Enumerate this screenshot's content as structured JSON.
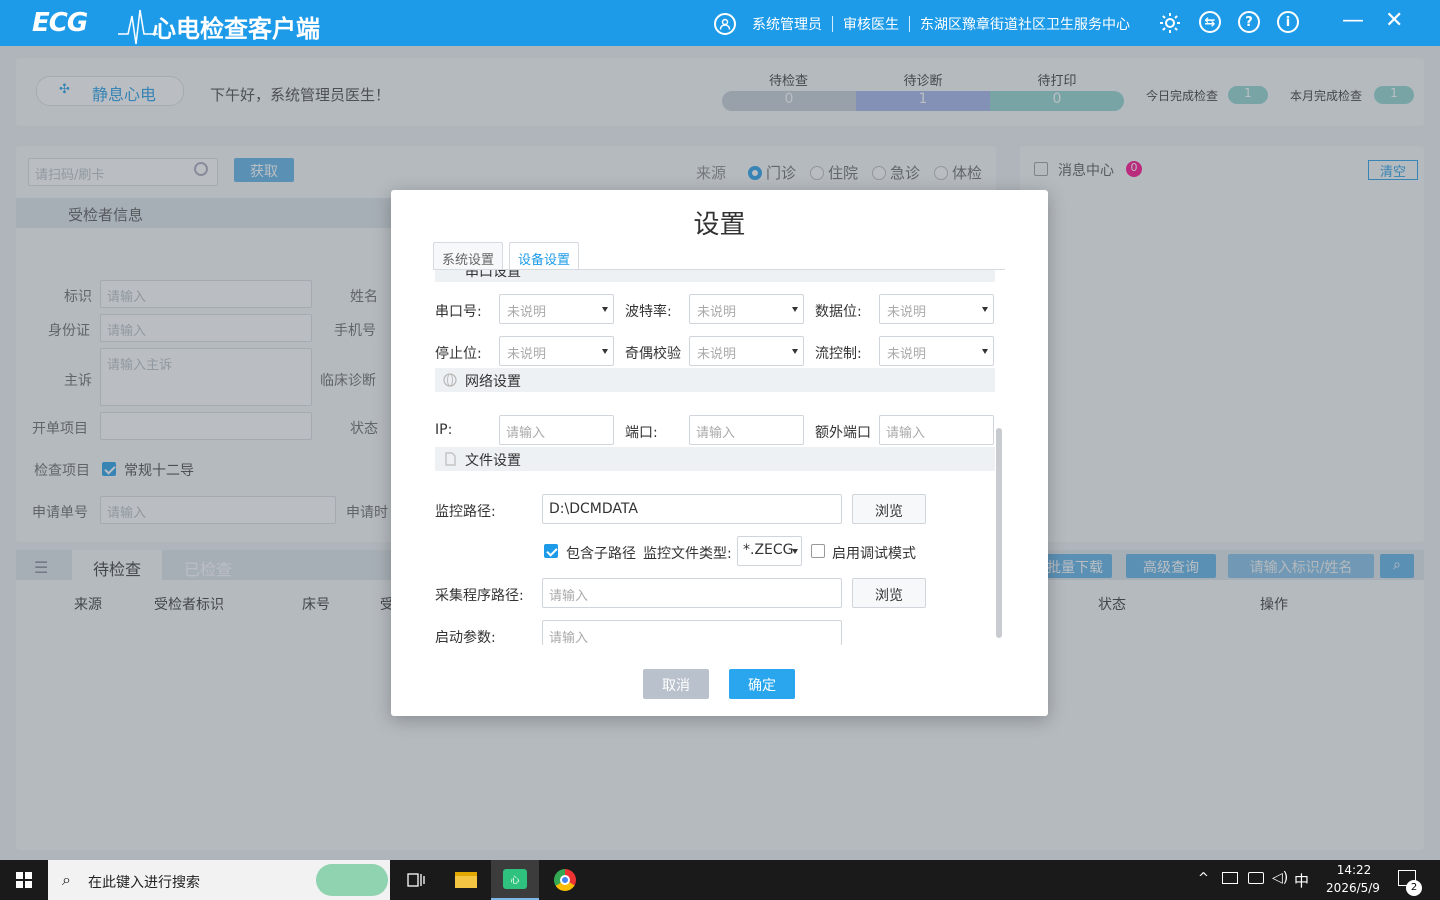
{
  "titlebar": {
    "logo": "ECG",
    "app_title": "心电检查客户端",
    "user": "系统管理员",
    "role": "审核医生",
    "org": "东湖区豫章街道社区卫生服务中心",
    "icons": [
      "gear-icon",
      "swap-icon",
      "help-icon",
      "info-icon"
    ],
    "minimize": "—",
    "close": "✕"
  },
  "header": {
    "mode_label": "静息心电",
    "greeting": "下午好，系统管理员医生！",
    "stats": [
      {
        "label": "待检查",
        "value": "0",
        "color": "#c5cdd5"
      },
      {
        "label": "待诊断",
        "value": "1",
        "color": "#9fb2e8"
      },
      {
        "label": "待打印",
        "value": "0",
        "color": "#8fd3cf"
      }
    ],
    "today_done_label": "今日完成检查",
    "today_done_value": "1",
    "month_done_label": "本月完成检查",
    "month_done_value": "1"
  },
  "scan": {
    "placeholder": "请扫码/刷卡",
    "fetch_button": "获取",
    "source_label": "来源",
    "sources": [
      "门诊",
      "住院",
      "急诊",
      "体检"
    ]
  },
  "patient": {
    "section_title": "受检者信息",
    "fields": {
      "id_label": "标识",
      "name_label": "姓名",
      "idcard_label": "身份证",
      "phone_label": "手机号",
      "complaint_label": "主诉",
      "diagnosis_label": "临床诊断",
      "order_label": "开单项目",
      "status_label": "状态",
      "exam_label": "检查项目",
      "exam_value": "常规十二导",
      "request_no_label": "申请单号",
      "request_time_label": "申请时"
    },
    "placeholder": "请输入",
    "complaint_placeholder": "请输入主诉"
  },
  "messages": {
    "title": "消息中心",
    "count": "0",
    "clear": "清空"
  },
  "list": {
    "tabs": [
      "待检查",
      "已检查"
    ],
    "columns": [
      "来源",
      "受检者标识",
      "床号",
      "受",
      "状态",
      "操作"
    ],
    "batch_download": "批量下载",
    "advanced_search": "高级查询",
    "search_placeholder": "请输入标识/姓名"
  },
  "modal": {
    "title": "设置",
    "tabs": [
      "系统设置",
      "设备设置"
    ],
    "serial_section": "串口设置",
    "serial": {
      "port_label": "串口号:",
      "baud_label": "波特率:",
      "databits_label": "数据位:",
      "stopbits_label": "停止位:",
      "parity_label": "奇偶校验",
      "flow_label": "流控制:",
      "unspecified": "未说明"
    },
    "network_section": "网络设置",
    "network": {
      "ip_label": "IP:",
      "port_label": "端口:",
      "extra_port_label": "额外端口",
      "placeholder": "请输入"
    },
    "file_section": "文件设置",
    "file": {
      "monitor_path_label": "监控路径:",
      "monitor_path_value": "D:\\DCMDATA",
      "browse": "浏览",
      "include_sub_label": "包含子路径",
      "file_type_label": "监控文件类型:",
      "file_type_value": "*.ZECG",
      "debug_label": "启用调试模式",
      "collector_path_label": "采集程序路径:",
      "start_args_label": "启动参数:",
      "placeholder": "请输入"
    },
    "cancel": "取消",
    "confirm": "确定"
  },
  "taskbar": {
    "search_placeholder": "在此键入进行搜索",
    "time": "14:22",
    "date": "2026/5/9",
    "ime": "中",
    "notifications": "2"
  }
}
